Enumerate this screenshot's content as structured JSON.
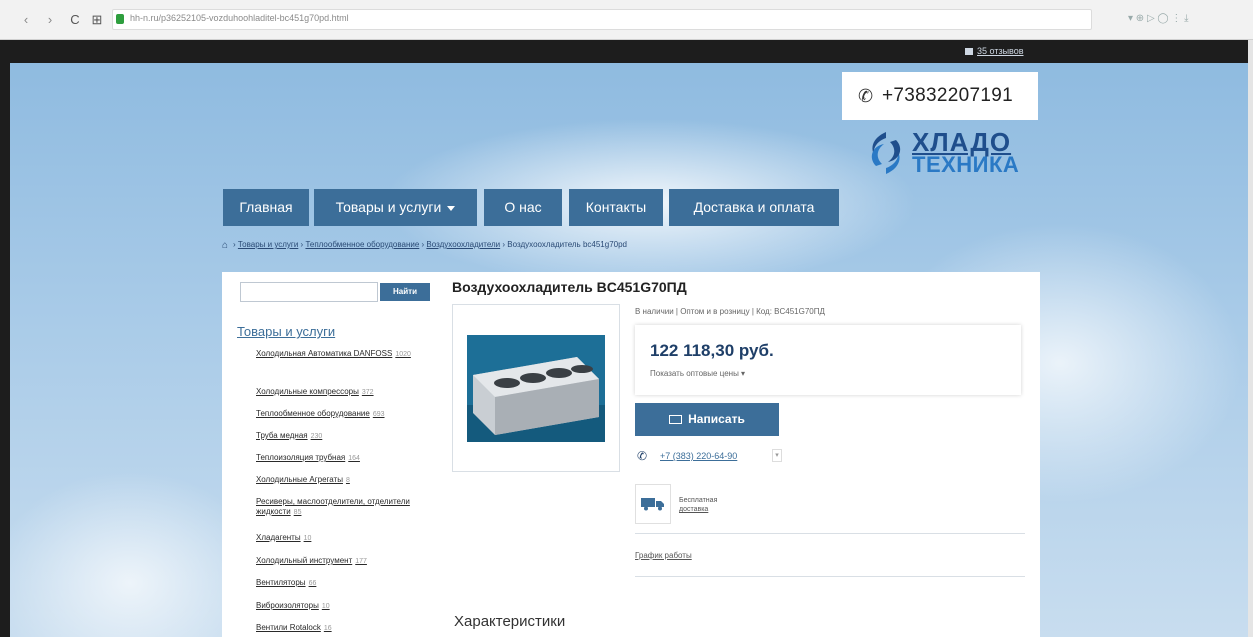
{
  "browser": {
    "back": "‹",
    "forward": "›",
    "reload": "C",
    "apps": "⊞",
    "url": "hh-n.ru/p36252105-vozduhoohladitel-bc451g70pd.html",
    "extensions": "▾ ⊕ ▷ ◯  ⋮  ⤓"
  },
  "topbar": {
    "cart_label": "35 отзывов"
  },
  "header": {
    "phone": "+73832207191",
    "logo_top": "ХЛАДО",
    "logo_bottom": "ТЕХНИКА"
  },
  "nav": {
    "items": [
      "Главная",
      "Товары и услуги",
      "О нас",
      "Контакты",
      "Доставка и оплата"
    ]
  },
  "breadcrumb": {
    "items": [
      "Товары и услуги",
      "Теплообменное оборудование",
      "Воздухоохладители"
    ],
    "separator": "›",
    "current": "Воздухоохладитель bc451g70pd"
  },
  "search": {
    "placeholder": "",
    "button": "Найти"
  },
  "sidebar": {
    "title": "Товары и услуги",
    "items": [
      {
        "label": "Холодильная Автоматика DANFOSS",
        "count": "1020"
      },
      {
        "label": "Холодильные компрессоры",
        "count": "372"
      },
      {
        "label": "Теплообменное оборудование",
        "count": "693"
      },
      {
        "label": "Труба медная",
        "count": "230"
      },
      {
        "label": "Теплоизоляция трубная",
        "count": "164"
      },
      {
        "label": "Холодильные Агрегаты",
        "count": "8"
      },
      {
        "label": "Ресиверы, маслоотделители, отделители жидкости",
        "count": "85"
      },
      {
        "label": "Хладагенты",
        "count": "10"
      },
      {
        "label": "Холодильный инструмент",
        "count": "177"
      },
      {
        "label": "Вентиляторы",
        "count": "66"
      },
      {
        "label": "Виброизоляторы",
        "count": "10"
      },
      {
        "label": "Вентили Rotalock",
        "count": "16"
      }
    ]
  },
  "product": {
    "title": "Воздухоохладитель BC451G70ПД",
    "meta": "В наличии | Оптом и в розницу | Код: BC451G70ПД",
    "price": "122 118,30 руб.",
    "wholesale_link": "Показать оптовые цены ▾",
    "write_button": "Написать",
    "phone": "+7 (383) 220-64-90",
    "delivery_line1": "Бесплатная",
    "delivery_line2": "доставка",
    "schedule": "График работы",
    "specs_title": "Характеристики"
  },
  "colors": {
    "nav_bg": "#3c6e99",
    "price": "#1f3f68",
    "logo_dark": "#1f4e8c",
    "logo_light": "#2a79c5"
  }
}
